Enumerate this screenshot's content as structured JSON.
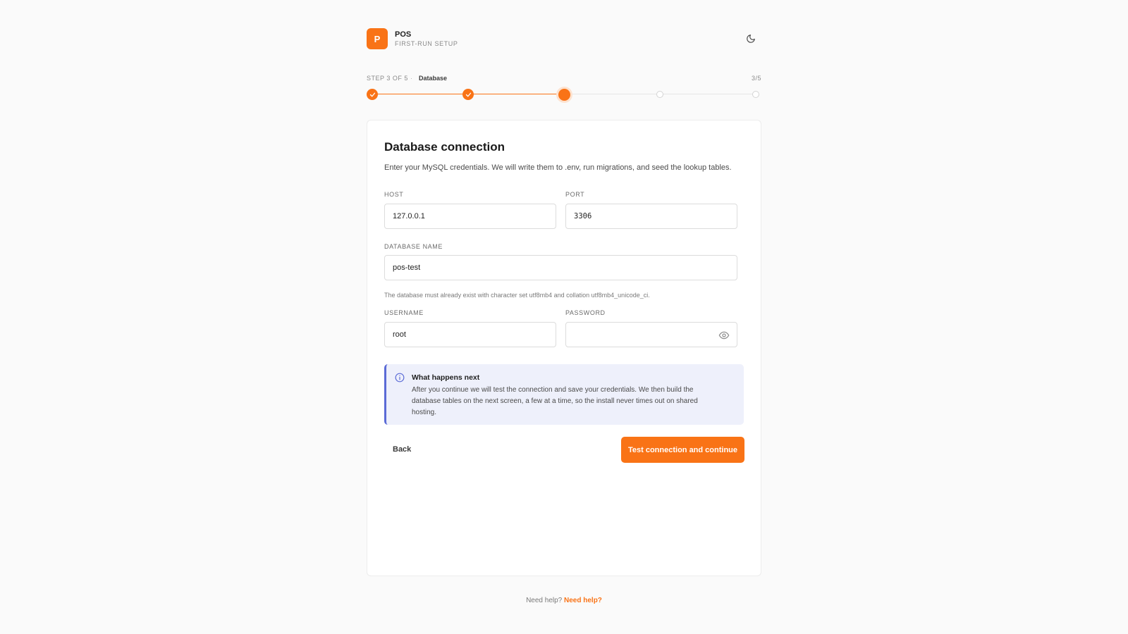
{
  "header": {
    "logo_letter": "P",
    "app_name": "POS",
    "app_subtitle": "FIRST-RUN SETUP",
    "theme_icon": "moon-icon"
  },
  "stepper": {
    "step_label": "STEP 3 OF 5",
    "separator": "·",
    "current_step_name": "Database",
    "ratio": "3/5",
    "current": 3,
    "total": 5,
    "accent": "#f97316"
  },
  "card": {
    "title": "Database connection",
    "description": "Enter your MySQL credentials. We will write them to .env, run migrations, and seed the lookup tables.",
    "fields": {
      "host": {
        "label": "HOST",
        "value": "127.0.0.1"
      },
      "port": {
        "label": "PORT",
        "value": "3306"
      },
      "database": {
        "label": "DATABASE NAME",
        "value": "pos-test",
        "hint": "The database must already exist with character set utf8mb4 and collation utf8mb4_unicode_ci."
      },
      "username": {
        "label": "USERNAME",
        "value": "root"
      },
      "password": {
        "label": "PASSWORD",
        "value": "",
        "toggle_icon": "eye-icon"
      }
    },
    "info": {
      "icon": "info-icon",
      "title": "What happens next",
      "text": "After you continue we will test the connection and save your credentials. We then build the database tables on the next screen, a few at a time, so the install never times out on shared hosting.",
      "accent": "#5b6bd6"
    },
    "actions": {
      "back_label": "Back",
      "primary_label": "Test connection and continue"
    }
  },
  "footer": {
    "prefix": "Need help?",
    "link_label": "Need help?"
  }
}
